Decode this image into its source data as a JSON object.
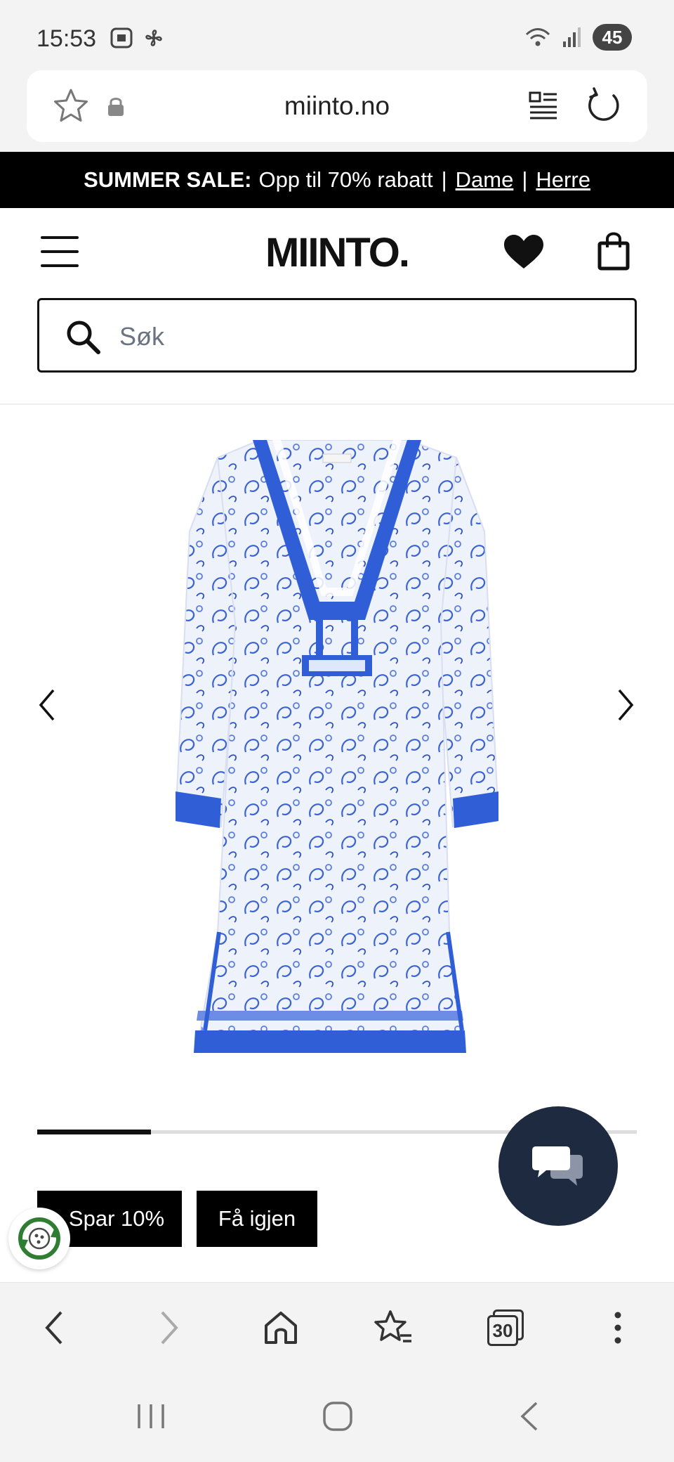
{
  "status_bar": {
    "time": "15:53",
    "battery": "45",
    "icons_left": [
      "screenshot-icon",
      "pinwheel-icon"
    ],
    "icons_right": [
      "wifi-icon",
      "signal-icon"
    ]
  },
  "url_bar": {
    "url": "miinto.no",
    "icons": [
      "star-icon",
      "lock-icon",
      "reader-mode-icon",
      "reload-icon"
    ]
  },
  "sale_banner": {
    "label": "SUMMER SALE:",
    "text": "Opp til 70% rabatt",
    "separator": "|",
    "link_women": "Dame",
    "link_men": "Herre"
  },
  "header": {
    "logo": "MIINTO.",
    "search_placeholder": "Søk"
  },
  "gallery": {
    "image_index_progress": 0.19,
    "accent_color": "#2f5ed6"
  },
  "tags": {
    "discount": "Spar 10%",
    "resale": "Få igjen"
  },
  "browser_nav": {
    "tabs_count": "30"
  },
  "colors": {
    "banner_bg": "#000000",
    "chat_bg": "#1e2a40",
    "eco_green": "#2e7d32"
  }
}
